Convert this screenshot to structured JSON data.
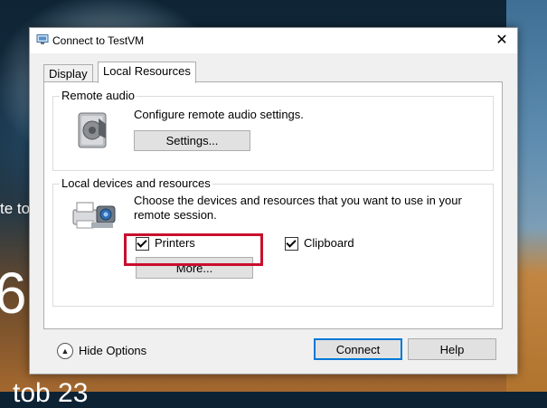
{
  "window": {
    "title": "Connect to TestVM",
    "close_glyph": "✕"
  },
  "tabs": [
    {
      "label": "Display",
      "selected": false
    },
    {
      "label": "Local Resources",
      "selected": true
    }
  ],
  "remote_audio": {
    "group_label": "Remote audio",
    "description": "Configure remote audio settings.",
    "settings_button": "Settings...",
    "icon": "speaker-icon"
  },
  "local_devices": {
    "group_label": "Local devices and resources",
    "description_line1": "Choose the devices and resources that you want to use in your",
    "description_line2": "remote session.",
    "icon": "printer-camera-icon",
    "printers": {
      "label": "Printers",
      "checked": true
    },
    "clipboard": {
      "label": "Clipboard",
      "checked": true
    },
    "more_button": "More..."
  },
  "footer": {
    "hide_options_label": "Hide Options",
    "hide_options_icon": "chevron-up-circle-icon",
    "connect_button": "Connect",
    "help_button": "Help"
  },
  "background": {
    "text_fragment": "te to",
    "digit_fragment": "6",
    "bottom_fragment": "tob 23"
  },
  "colors": {
    "highlight": "#c8102e",
    "accent": "#0078d7"
  }
}
